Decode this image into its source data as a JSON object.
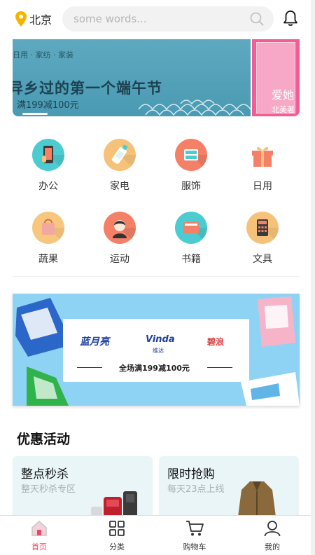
{
  "header": {
    "location": "北京",
    "search_placeholder": "some words..."
  },
  "banner_top": {
    "small_text": "日用 · 家纺 · 家装",
    "title": "异乡过的第一个端午节",
    "subtitle": "满199减100元",
    "side_title": "爱她",
    "side_sub": "北美著"
  },
  "categories": [
    {
      "label": "办公",
      "icon": "phone-icon",
      "color": "#4ccbd1"
    },
    {
      "label": "家电",
      "icon": "bottle-icon",
      "color": "#f6c27a"
    },
    {
      "label": "服饰",
      "icon": "clothes-icon",
      "color": "#f38067"
    },
    {
      "label": "日用",
      "icon": "gift-icon",
      "color": "#f38067"
    },
    {
      "label": "蔬果",
      "icon": "bag-icon",
      "color": "#f8c77e"
    },
    {
      "label": "运动",
      "icon": "person-icon",
      "color": "#f38067"
    },
    {
      "label": "书籍",
      "icon": "book-icon",
      "color": "#4ccbd1"
    },
    {
      "label": "文具",
      "icon": "calculator-icon",
      "color": "#f6c27a"
    }
  ],
  "banner_promo": {
    "brand1": "蓝月亮",
    "brand2": "Vinda",
    "brand2_sub": "维达",
    "brand3": "碧浪",
    "promo": "全场满199减100元"
  },
  "section": {
    "title": "优惠活动",
    "cards": [
      {
        "title": "整点秒杀",
        "subtitle": "整天秒杀专区"
      },
      {
        "title": "限时抢购",
        "subtitle": "每天23点上线"
      }
    ]
  },
  "tabbar": {
    "tabs": [
      {
        "label": "首页",
        "icon": "home-icon",
        "active": true
      },
      {
        "label": "分类",
        "icon": "grid-icon",
        "active": false
      },
      {
        "label": "购物车",
        "icon": "cart-icon",
        "active": false
      },
      {
        "label": "我的",
        "icon": "user-icon",
        "active": false
      }
    ]
  },
  "colors": {
    "accent": "#e14c6b",
    "location_pin": "#f5b400"
  }
}
